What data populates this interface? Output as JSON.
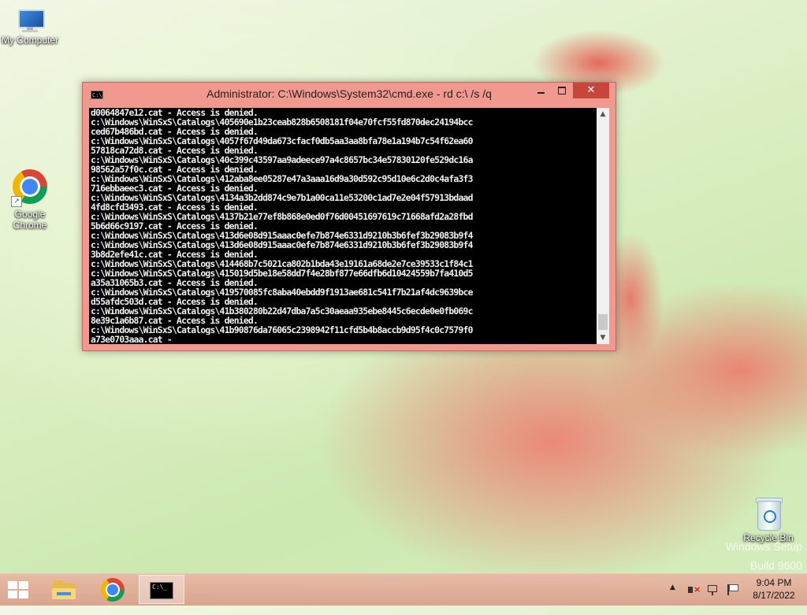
{
  "desktop": {
    "icons": [
      {
        "label": "My Computer"
      },
      {
        "label": "Google\nChrome"
      },
      {
        "label": "Recycle Bin"
      }
    ],
    "watermark": {
      "line1": "Windows Setup",
      "line2": "Build 9600"
    }
  },
  "window": {
    "title": "Administrator: C:\\Windows\\System32\\cmd.exe - rd  c:\\ /s /q",
    "icon_text": "C:\\",
    "buttons": {
      "minimize": "minimize",
      "maximize": "maximize",
      "close": "✕"
    },
    "console_lines": [
      "d0064847e12.cat - Access is denied.",
      "c:\\Windows\\WinSxS\\Catalogs\\405690e1b23ceab828b6508181f04e70fcf55fd870dec24194bcc",
      "ced67b486bd.cat - Access is denied.",
      "c:\\Windows\\WinSxS\\Catalogs\\4057f67d49da673cfacf0db5aa3aa8bfa78e1a194b7c54f62ea60",
      "57818ca72d8.cat - Access is denied.",
      "c:\\Windows\\WinSxS\\Catalogs\\40c399c43597aa9adeece97a4c8657bc34e57830120fe529dc16a",
      "98562a57f0c.cat - Access is denied.",
      "c:\\Windows\\WinSxS\\Catalogs\\412aba8ee05287e47a3aaa16d9a30d592c95d10e6c2d0c4afa3f3",
      "716ebbaeec3.cat - Access is denied.",
      "c:\\Windows\\WinSxS\\Catalogs\\4134a3b2dd874c9e7b1a00ca11e53200c1ad7e2e04f57913bdaad",
      "4fd8cfd3493.cat - Access is denied.",
      "c:\\Windows\\WinSxS\\Catalogs\\4137b21e77ef8b868e0ed0f76d00451697619c71668afd2a28fbd",
      "5b6d66c9197.cat - Access is denied.",
      "c:\\Windows\\WinSxS\\Catalogs\\413d6e08d915aaac0efe7b874e6331d9210b3b6fef3b29083b9f4",
      "c:\\Windows\\WinSxS\\Catalogs\\413d6e08d915aaac0efe7b874e6331d9210b3b6fef3b29083b9f4",
      "3b8d2efe41c.cat - Access is denied.",
      "c:\\Windows\\WinSxS\\Catalogs\\414468b7c5021ca802b1bda43e19161a68de2e7ce39533c1f84c1",
      "c:\\Windows\\WinSxS\\Catalogs\\415019d5be18e58dd7f4e28bf877e66dfb6d10424559b7fa410d5",
      "a35a31065b3.cat - Access is denied.",
      "c:\\Windows\\WinSxS\\Catalogs\\419570085fc8aba40ebdd9f1913ae681c541f7b21af4dc9639bce",
      "d55afdc503d.cat - Access is denied.",
      "c:\\Windows\\WinSxS\\Catalogs\\41b380280b22d47dba7a5c30aeaa935ebe8445c6ecde0e0fb069c",
      "8e39c1a6b87.cat - Access is denied.",
      "c:\\Windows\\WinSxS\\Catalogs\\41b90876da76065c2398942f11cfd5b4b8accb9d95f4c0c7579f0",
      "a73e0703aaa.cat -"
    ],
    "scroll": {
      "up": "▲",
      "down": "▼"
    }
  },
  "taskbar": {
    "cmd_icon_text": "C:\\_",
    "tray_arrow": "▲",
    "clock": {
      "time": "9:04 PM",
      "date": "8/17/2022"
    }
  }
}
